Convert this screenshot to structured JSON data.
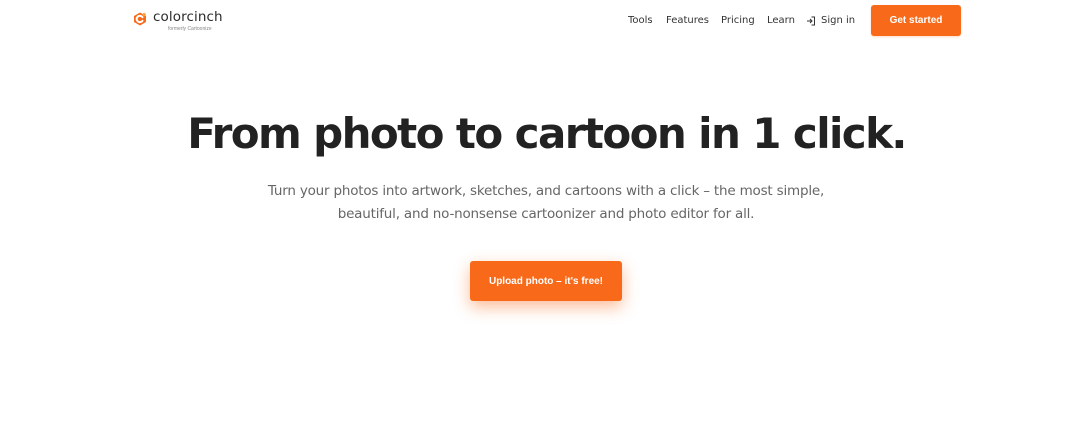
{
  "brand": {
    "name": "colorcinch",
    "tagline": "formerly Cartoonize",
    "accent_color": "#f86a1a",
    "logo_icon": "colorcinch-logo-icon"
  },
  "nav": {
    "links": [
      "Tools",
      "Features",
      "Pricing",
      "Learn"
    ],
    "signin_label": "Sign in",
    "signin_icon": "sign-in-icon",
    "cta_label": "Get started"
  },
  "hero": {
    "title": "From photo to cartoon in 1 click.",
    "subtitle": "Turn your photos into artwork, sketches, and cartoons with a click – the most simple, beautiful, and no-nonsense cartoonizer and photo editor for all.",
    "cta_label": "Upload photo – it's free!"
  }
}
